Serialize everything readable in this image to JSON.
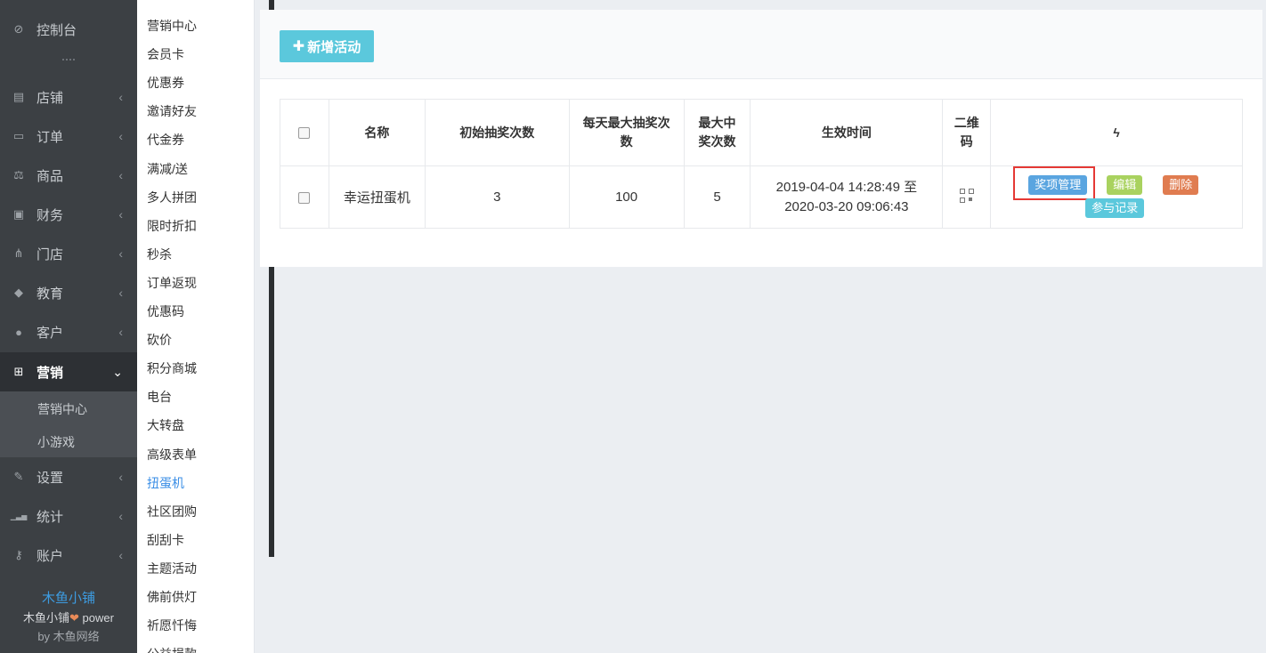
{
  "sidebar": {
    "items": [
      {
        "icon": "dashboard-icon",
        "glyph": "⊘",
        "label": "控制台",
        "chevron": ""
      },
      {
        "icon": "store-icon",
        "glyph": "▤",
        "label": "店铺",
        "chevron": "‹"
      },
      {
        "icon": "order-icon",
        "glyph": "▭",
        "label": "订单",
        "chevron": "‹"
      },
      {
        "icon": "scale-icon",
        "glyph": "⚖",
        "label": "商品",
        "chevron": "‹"
      },
      {
        "icon": "money-icon",
        "glyph": "▣",
        "label": "财务",
        "chevron": "‹"
      },
      {
        "icon": "sitemap-icon",
        "glyph": "⋔",
        "label": "门店",
        "chevron": "‹"
      },
      {
        "icon": "graduation-cap-icon",
        "glyph": "◆",
        "label": "教育",
        "chevron": "‹"
      },
      {
        "icon": "users-icon",
        "glyph": "●",
        "label": "客户",
        "chevron": "‹"
      },
      {
        "icon": "gift-icon",
        "glyph": "⊞",
        "label": "营销",
        "chevron": "⌄"
      },
      {
        "icon": "wrench-icon",
        "glyph": "✎",
        "label": "设置",
        "chevron": "‹"
      },
      {
        "icon": "signal-icon",
        "glyph": "▁▃▅",
        "label": "统计",
        "chevron": "‹"
      },
      {
        "icon": "key-icon",
        "glyph": "⚷",
        "label": "账户",
        "chevron": "‹"
      }
    ],
    "sub_items": [
      "营销中心",
      "小游戏"
    ],
    "brand_name": "木鱼小铺",
    "brand_power_pre": "木鱼小铺",
    "brand_heart": "❤",
    "brand_power_post": " power",
    "brand_by": "by 木鱼网络"
  },
  "submenu": {
    "items": [
      "营销中心",
      "会员卡",
      "优惠券",
      "邀请好友",
      "代金券",
      "满减/送",
      "多人拼团",
      "限时折扣",
      "秒杀",
      "订单返现",
      "优惠码",
      "砍价",
      "积分商城",
      "电台",
      "大转盘",
      "高级表单",
      "扭蛋机",
      "社区团购",
      "刮刮卡",
      "主题活动",
      "佛前供灯",
      "祈愿忏悔",
      "公益捐款"
    ],
    "current": "扭蛋机"
  },
  "toolbar": {
    "add_plus": "✚",
    "add_label": "新增活动"
  },
  "table": {
    "headers": {
      "name": "名称",
      "initial_draws": "初始抽奖次数",
      "daily_max_a": "每天最大抽奖次",
      "daily_max_b": "数",
      "max_win_a": "最大中",
      "max_win_b": "奖次数",
      "effective_time": "生效时间",
      "qr_a": "二维",
      "qr_b": "码",
      "actions_icon": "ϟ"
    },
    "rows": [
      {
        "name": "幸运扭蛋机",
        "initial_draws": "3",
        "daily_max": "100",
        "max_win": "5",
        "time_line1": "2019-04-04 14:28:49 至",
        "time_line2": "2020-03-20 09:06:43",
        "actions": {
          "prize_manage": "奖项管理",
          "edit": "编辑",
          "delete": "删除",
          "records": "参与记录"
        }
      }
    ]
  },
  "colors": {
    "sidebar_bg": "#3c4044",
    "accent_cyan": "#5bc8dc",
    "tag_blue": "#5aa5e0",
    "tag_green": "#a9d25f",
    "tag_orange": "#e07c50",
    "highlight_red": "#e53935",
    "link_blue": "#3a8ee6"
  }
}
